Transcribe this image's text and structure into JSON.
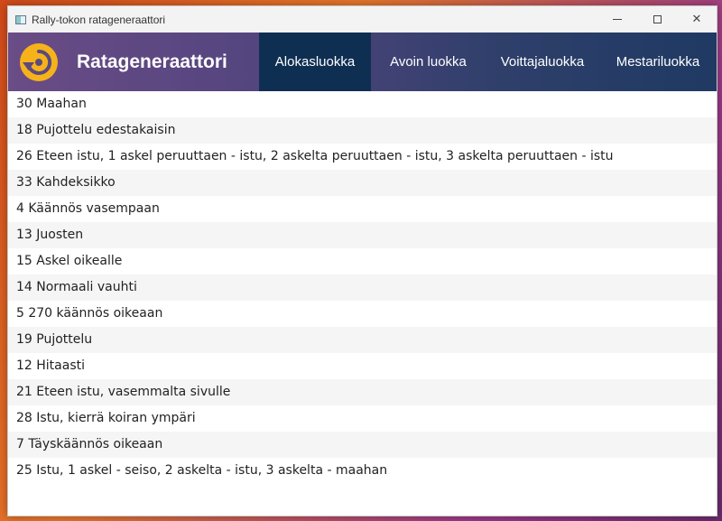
{
  "window": {
    "title": "Rally-tokon ratageneraattori",
    "controls": {
      "minimize": "",
      "maximize": "",
      "close": "✕"
    }
  },
  "header": {
    "brand_title": "Ratageneraattori",
    "logo_icon": "cycle-arrow-icon",
    "accent_color": "#f5b21b",
    "tabs": [
      {
        "label": "Alokasluokka",
        "active": true
      },
      {
        "label": "Avoin luokka",
        "active": false
      },
      {
        "label": "Voittajaluokka",
        "active": false
      },
      {
        "label": "Mestariluokka",
        "active": false
      }
    ]
  },
  "course": {
    "items": [
      "30 Maahan",
      "18 Pujottelu edestakaisin",
      "26 Eteen istu, 1 askel peruuttaen - istu, 2 askelta peruuttaen - istu, 3 askelta peruuttaen - istu",
      "33 Kahdeksikko",
      "4 Käännös vasempaan",
      "13 Juosten",
      "15 Askel oikealle",
      "14 Normaali vauhti",
      "5 270 käännös oikeaan",
      "19 Pujottelu",
      "12 Hitaasti",
      "21 Eteen istu, vasemmalta sivulle",
      "28 Istu, kierrä koiran ympäri",
      "7 Täyskäännös oikeaan",
      "25 Istu, 1 askel - seiso, 2 askelta - istu, 3 askelta - maahan"
    ]
  }
}
